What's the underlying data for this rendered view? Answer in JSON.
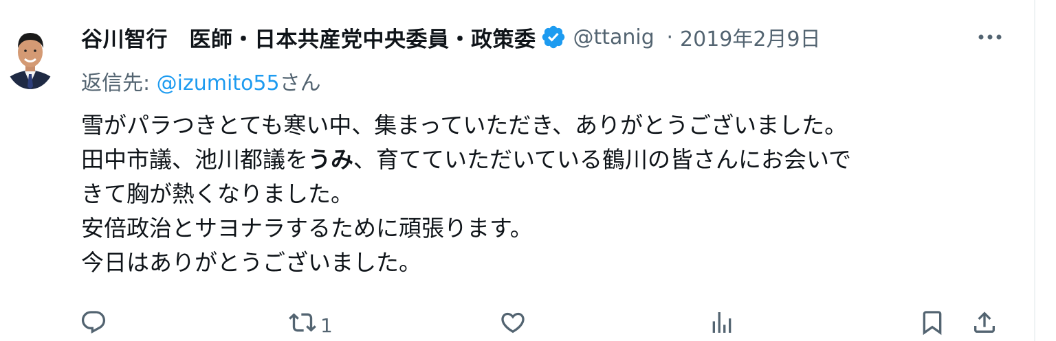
{
  "tweet": {
    "display_name": "谷川智行　医師・日本共産党中央委員・政策委",
    "handle": "@ttanig",
    "separator": "·",
    "date": "2019年2月9日",
    "reply_label": "返信先: ",
    "reply_mention": "@izumito55",
    "reply_suffix": "さん",
    "body": {
      "line1": "雪がパラつきとても寒い中、集まっていただき、ありがとうございました。",
      "line2_a": "田中市議、池川都議を",
      "line2_bold": "うみ",
      "line2_b": "、育てていただいている鶴川の皆さんにお会いで",
      "line3": "きて胸が熱くなりました。",
      "line4": "安倍政治とサヨナラするために頑張ります。",
      "line5": "今日はありがとうございました。"
    }
  },
  "actions": {
    "reply_icon": "reply-icon",
    "retweet_icon": "retweet-icon",
    "retweet_count": "1",
    "like_icon": "heart-icon",
    "views_icon": "views-icon",
    "bookmark_icon": "bookmark-icon",
    "share_icon": "share-icon"
  },
  "colors": {
    "text": "#0f1419",
    "secondary": "#536471",
    "accent": "#1d9bf0"
  }
}
